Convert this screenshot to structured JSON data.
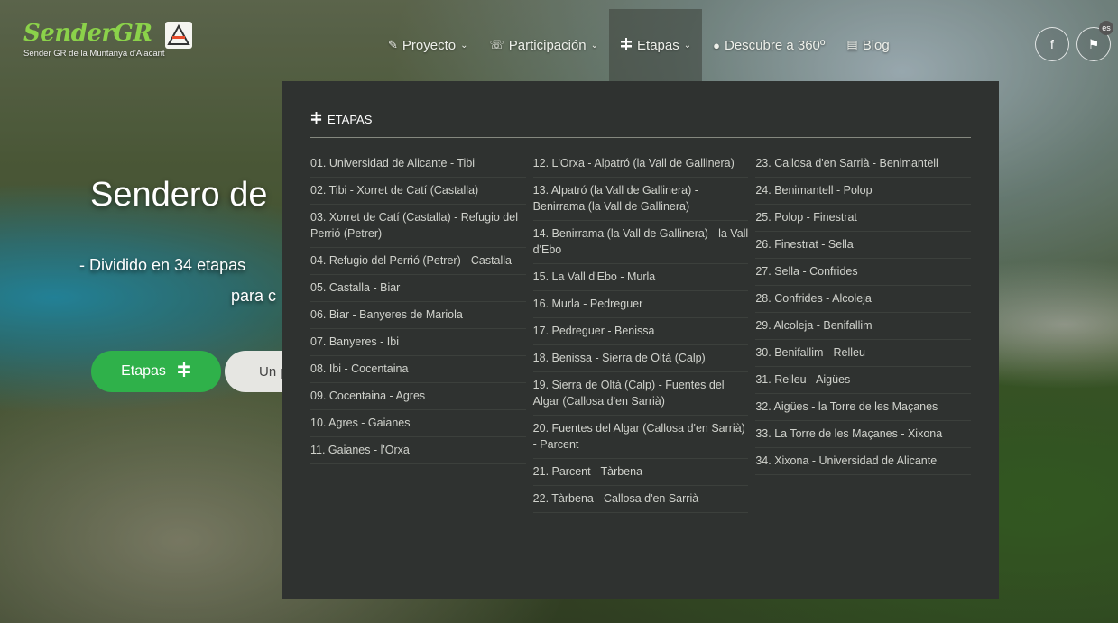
{
  "logo": {
    "name": "SenderGR",
    "subtitle": "Sender GR de la Muntanya d'Alacant"
  },
  "nav": {
    "items": [
      {
        "icon": "✎",
        "label": "Proyecto",
        "chevron": "⌄"
      },
      {
        "icon": "☏",
        "label": "Participación",
        "chevron": "⌄"
      },
      {
        "icon": "⚑",
        "label": "Etapas",
        "chevron": "⌄"
      },
      {
        "icon": "●",
        "label": "Descubre a 360º",
        "chevron": ""
      },
      {
        "icon": "▤",
        "label": "Blog",
        "chevron": ""
      }
    ]
  },
  "social": {
    "facebook": "f",
    "lang": "⚑",
    "lang_badge": "es"
  },
  "hero": {
    "title": "Sendero de",
    "subtitle": "- Dividido en 34 etapas",
    "subtitle2": "para c",
    "btn_etapas": "Etapas",
    "btn_other": "Un p"
  },
  "dropdown": {
    "title": "ETAPAS",
    "col1": [
      "01. Universidad de Alicante - Tibi",
      "02. Tibi - Xorret de Catí (Castalla)",
      "03. Xorret de Catí (Castalla) - Refugio del Perrió (Petrer)",
      "04. Refugio del Perrió (Petrer) - Castalla",
      "05. Castalla - Biar",
      "06. Biar - Banyeres de Mariola",
      "07. Banyeres - Ibi",
      "08. Ibi - Cocentaina",
      "09. Cocentaina - Agres",
      "10. Agres - Gaianes",
      "11. Gaianes - l'Orxa"
    ],
    "col2": [
      "12. L'Orxa - Alpatró (la Vall de Gallinera)",
      "13. Alpatró (la Vall de Gallinera) - Benirrama (la Vall de Gallinera)",
      "14. Benirrama (la Vall de Gallinera) - la Vall d'Ebo",
      "15. La Vall d'Ebo - Murla",
      "16. Murla - Pedreguer",
      "17. Pedreguer - Benissa",
      "18. Benissa - Sierra de Oltà (Calp)",
      "19. Sierra de Oltà (Calp) - Fuentes del Algar (Callosa d'en Sarrià)",
      "20. Fuentes del Algar (Callosa d'en Sarrià) - Parcent",
      "21. Parcent - Tàrbena",
      "22. Tàrbena - Callosa d'en Sarrià"
    ],
    "col3": [
      "23. Callosa d'en Sarrià - Benimantell",
      "24. Benimantell - Polop",
      "25. Polop - Finestrat",
      "26. Finestrat - Sella",
      "27. Sella - Confrides",
      "28. Confrides - Alcoleja",
      "29. Alcoleja - Benifallim",
      "30. Benifallim - Relleu",
      "31. Relleu - Aigües",
      "32. Aigües - la Torre de les Maçanes",
      "33. La Torre de les Maçanes - Xixona",
      "34. Xixona - Universidad de Alicante"
    ]
  }
}
